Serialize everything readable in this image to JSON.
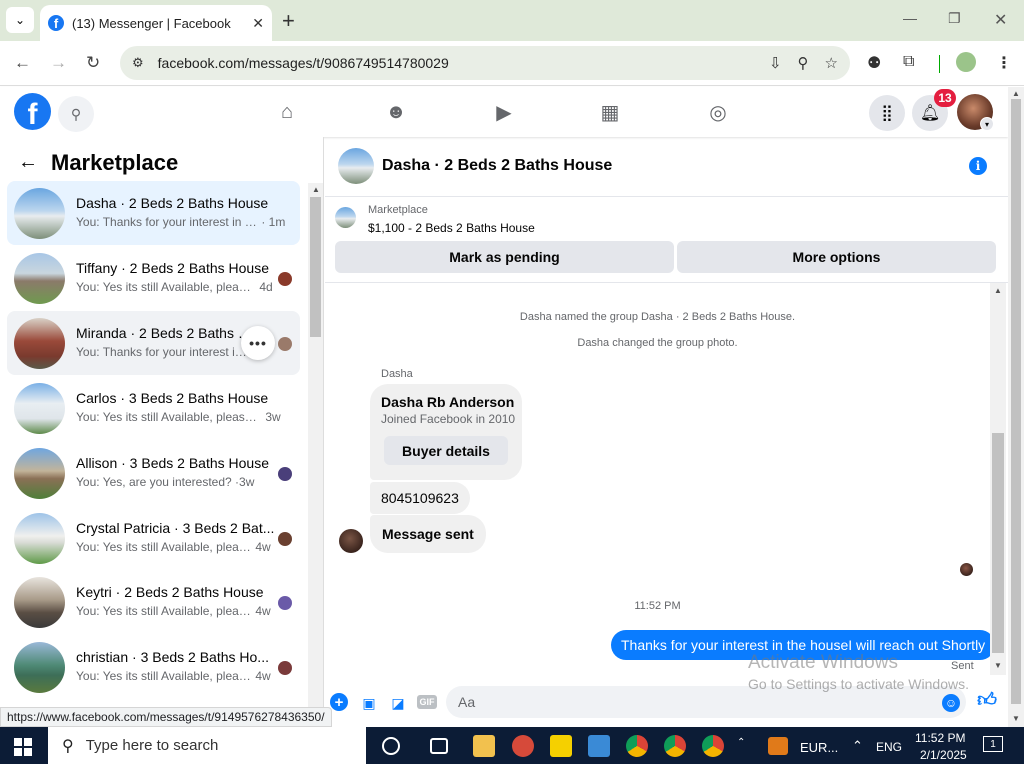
{
  "browser": {
    "tab_title": "(13) Messenger | Facebook",
    "url": "facebook.com/messages/t/9086749514780029",
    "status_url": "https://www.facebook.com/messages/t/9149576278436350/"
  },
  "header": {
    "notif_count": "13"
  },
  "left": {
    "title": "Marketplace",
    "conversations": [
      {
        "name": "Dasha · 2 Beds 2 Baths House",
        "snippet": "You: Thanks for your interest in th...",
        "time": "· 1m"
      },
      {
        "name": "Tiffany · 2 Beds 2 Baths House",
        "snippet": "You: Yes its still Available, please...",
        "time": "4d"
      },
      {
        "name": "Miranda · 2 Beds 2 Baths House",
        "snippet": "You: Thanks for your interest in ...",
        "time": ""
      },
      {
        "name": "Carlos · 3 Beds 2 Baths House",
        "snippet": "You: Yes its still Available, please s...",
        "time": "3w"
      },
      {
        "name": "Allison · 3 Beds 2 Baths House",
        "snippet": "You: Yes, are you interested? ·",
        "time": "3w"
      },
      {
        "name": "Crystal Patricia · 3 Beds 2 Bat...",
        "snippet": "You: Yes its still Available, pleas...",
        "time": "4w"
      },
      {
        "name": "Keytri · 2 Beds 2 Baths House",
        "snippet": "You: Yes its still Available, pleas...",
        "time": "4w"
      },
      {
        "name": "christian · 3 Beds 2 Baths Ho...",
        "snippet": "You: Yes its still Available, pleas...",
        "time": "4w"
      }
    ]
  },
  "chat": {
    "title": "Dasha · 2 Beds 2 Baths House",
    "marketplace_label": "Marketplace",
    "listing": "$1,100 - 2 Beds 2 Baths House",
    "mark_pending": "Mark as pending",
    "more_options": "More options",
    "system_msgs": [
      "Dasha named the group Dasha · 2 Beds 2 Baths House.",
      "Dasha changed the group photo."
    ],
    "sender": "Dasha",
    "buyer_name": "Dasha Rb Anderson",
    "buyer_joined": "Joined Facebook in 2010",
    "buyer_details": "Buyer details",
    "phone": "8045109623",
    "message_sent": "Message sent",
    "timestamp": "11:52 PM",
    "my_message": "Thanks for your interest in the houseI will reach out Shortly",
    "sent_label": "Sent",
    "composer_placeholder": "Aa"
  },
  "watermark": {
    "line1": "Activate Windows",
    "line2": "Go to Settings to activate Windows."
  },
  "taskbar": {
    "search_placeholder": "Type here to search",
    "currency": "EUR...",
    "lang": "ENG",
    "time": "11:52 PM",
    "date": "2/1/2025",
    "notif": "1"
  }
}
